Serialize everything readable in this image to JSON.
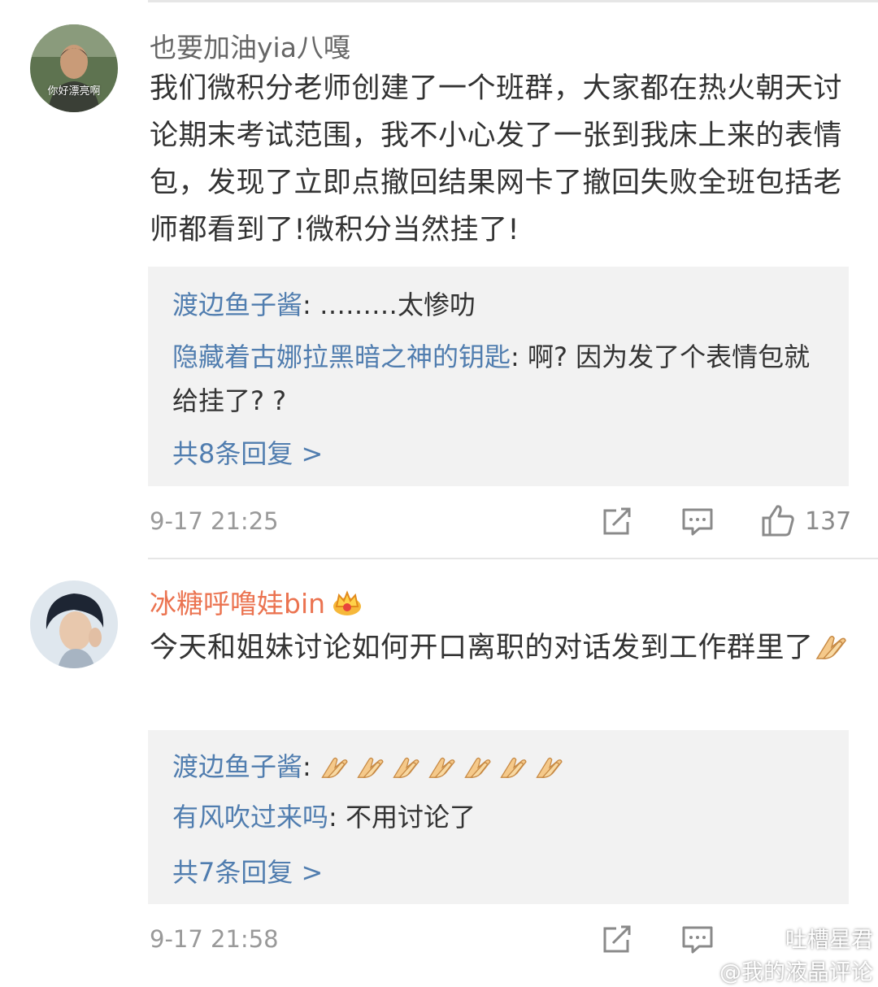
{
  "comments": [
    {
      "username": "也要加油yia八嘎",
      "avatar_caption": "你好漂亮啊",
      "text": "我们微积分老师创建了一个班群，大家都在热火朝天讨论期末考试范围，我不小心发了一张到我床上来的表情包，发现了立即点撤回结果网卡了撤回失败全班包括老师都看到了!微积分当然挂了!",
      "replies": [
        {
          "name": "渡边鱼子酱",
          "text": ": ………太惨叻"
        },
        {
          "name": "隐藏着古娜拉黑暗之神的钥匙",
          "text": ": 啊? 因为发了个表情包就给挂了? ?"
        }
      ],
      "more_replies": "共8条回复 >",
      "time": "9-17 21:25",
      "likes": "137"
    },
    {
      "username": "冰糖呼噜娃bin",
      "text": "今天和姐妹讨论如何开口离职的对话发到工作群里了",
      "replies": [
        {
          "name": "渡边鱼子酱",
          "text": ": "
        },
        {
          "name": "有风吹过来吗",
          "text": ": 不用讨论了"
        }
      ],
      "more_replies": "共7条回复 >",
      "time": "9-17 21:58"
    }
  ],
  "watermark": {
    "line1": "吐槽星君",
    "line2": "@我的液晶评论"
  },
  "colors": {
    "link": "#507daf",
    "vip_name": "#eb7350",
    "meta": "#999999",
    "reply_bg": "#f2f2f2"
  },
  "icons": [
    "share-icon",
    "comment-icon",
    "like-icon",
    "crown-badge-icon",
    "clap-emoji-icon",
    "weibo-logo-icon"
  ]
}
